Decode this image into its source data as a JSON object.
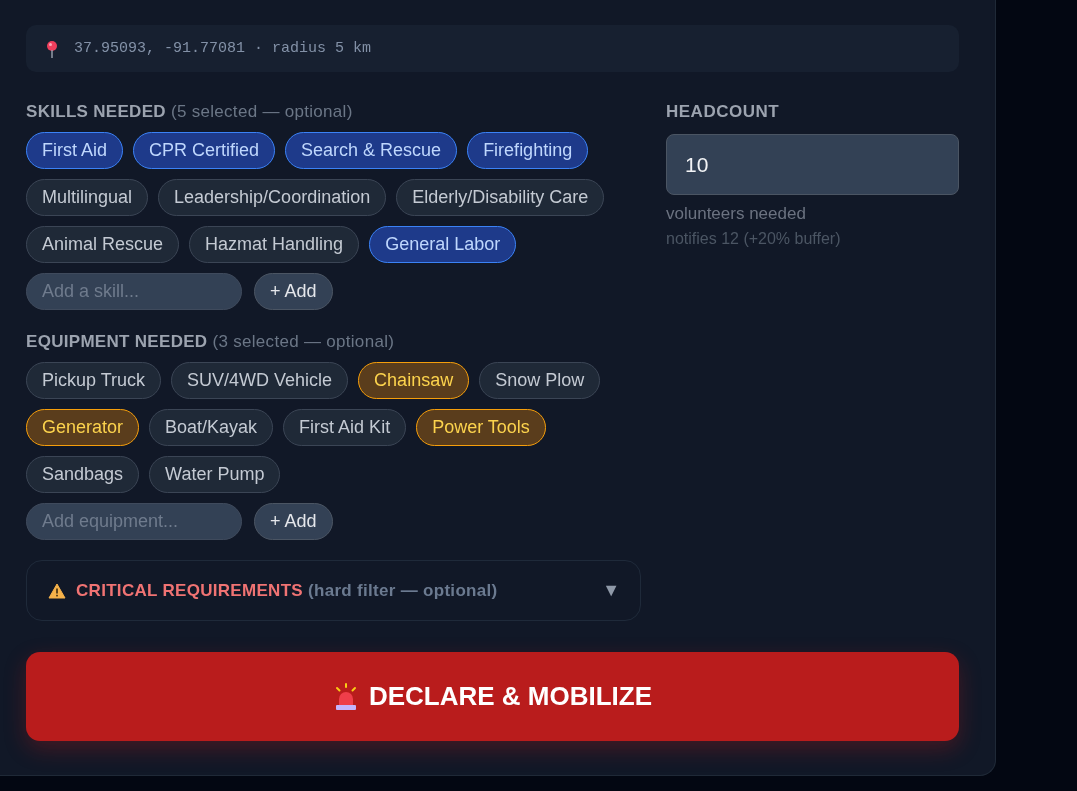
{
  "location": {
    "text": "37.95093, -91.77081 · radius 5 km"
  },
  "skills": {
    "title": "**SKILLS NEEDED** (5 selected — optional)",
    "items": [
      {
        "label": "First Aid",
        "selected": true
      },
      {
        "label": "CPR Certified",
        "selected": true
      },
      {
        "label": "Search & Rescue",
        "selected": true
      },
      {
        "label": "Firefighting",
        "selected": true
      },
      {
        "label": "Multilingual",
        "selected": false
      },
      {
        "label": "Leadership/Coordination",
        "selected": false
      },
      {
        "label": "Elderly/Disability Care",
        "selected": false
      },
      {
        "label": "Animal Rescue",
        "selected": false
      },
      {
        "label": "Hazmat Handling",
        "selected": false
      },
      {
        "label": "General Labor",
        "selected": true
      }
    ],
    "add_placeholder": "Add a skill...",
    "add_button": "+ Add"
  },
  "equipment": {
    "title": "**EQUIPMENT NEEDED** (3 selected — optional)",
    "items": [
      {
        "label": "Pickup Truck",
        "selected": false
      },
      {
        "label": "SUV/4WD Vehicle",
        "selected": false
      },
      {
        "label": "Chainsaw",
        "selected": true
      },
      {
        "label": "Snow Plow",
        "selected": false
      },
      {
        "label": "Generator",
        "selected": true
      },
      {
        "label": "Boat/Kayak",
        "selected": false
      },
      {
        "label": "First Aid Kit",
        "selected": false
      },
      {
        "label": "Power Tools",
        "selected": true
      },
      {
        "label": "Sandbags",
        "selected": false
      },
      {
        "label": "Water Pump",
        "selected": false
      }
    ],
    "add_placeholder": "Add equipment...",
    "add_button": "+ Add"
  },
  "headcount": {
    "title": "HEADCOUNT",
    "value": "10",
    "caption": "volunteers needed",
    "note": "notifies 12 (+20% buffer)"
  },
  "critical": {
    "title": "**CRITICAL REQUIREMENTS** (hard filter — optional)",
    "caret": "▼",
    "expanded": false
  },
  "submit": {
    "label": "DECLARE & MOBILIZE"
  }
}
